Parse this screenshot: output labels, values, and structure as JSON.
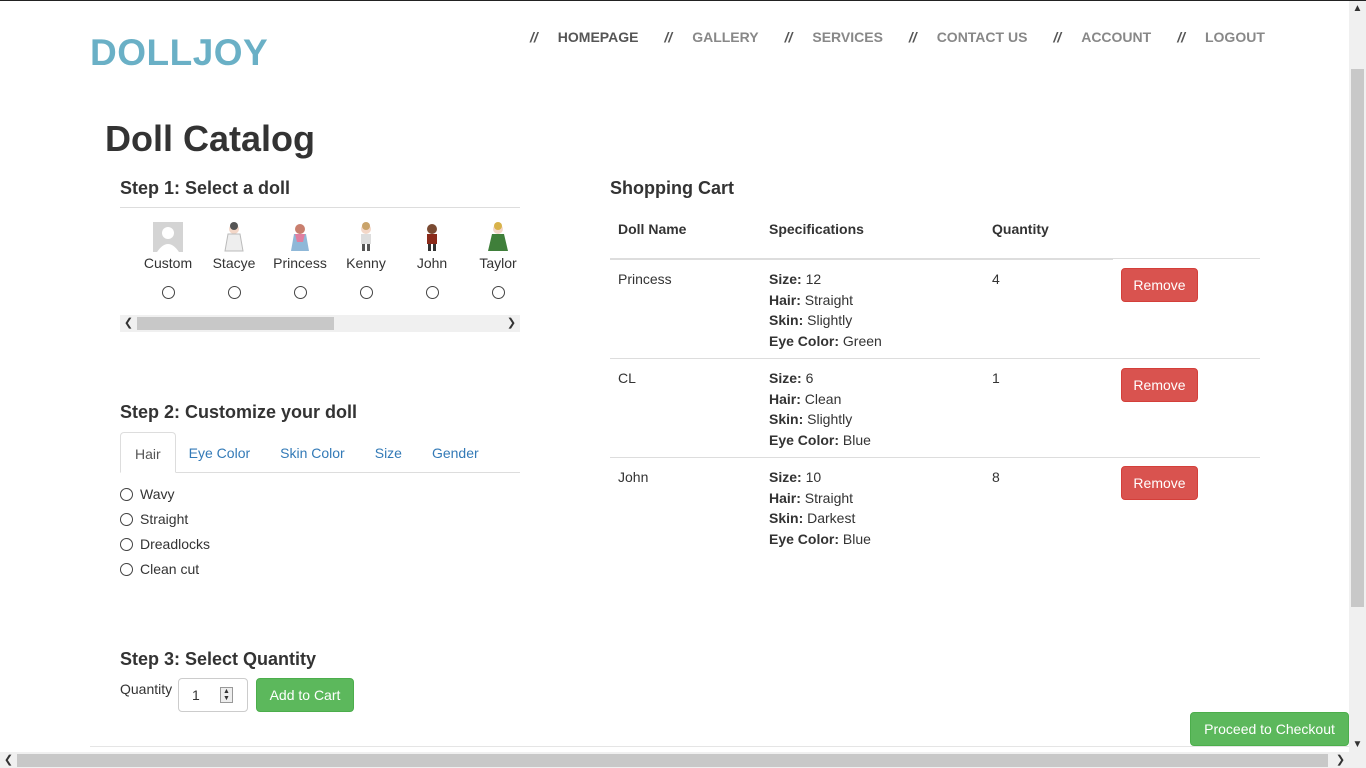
{
  "header": {
    "brand": "DOLLJOY",
    "separator": "//",
    "nav": [
      {
        "label": "HOMEPAGE",
        "active": true
      },
      {
        "label": "GALLERY",
        "active": false
      },
      {
        "label": "SERVICES",
        "active": false
      },
      {
        "label": "CONTACT US",
        "active": false
      },
      {
        "label": "ACCOUNT",
        "active": false
      },
      {
        "label": "LOGOUT",
        "active": false
      }
    ]
  },
  "page_title": "Doll Catalog",
  "step1": {
    "heading": "Step 1: Select a doll",
    "dolls": [
      {
        "name": "Custom",
        "icon": "custom-avatar-icon",
        "color": "#b5b5b5"
      },
      {
        "name": "Stacye",
        "icon": "doll-stacye-icon",
        "color": "#e8e8e8"
      },
      {
        "name": "Princess",
        "icon": "doll-princess-icon",
        "color": "#8fb8d8"
      },
      {
        "name": "Kenny",
        "icon": "doll-kenny-icon",
        "color": "#d8d8d8"
      },
      {
        "name": "John",
        "icon": "doll-john-icon",
        "color": "#7a3a2a"
      },
      {
        "name": "Taylor",
        "icon": "doll-taylor-icon",
        "color": "#3f7f3a"
      }
    ]
  },
  "step2": {
    "heading": "Step 2: Customize your doll",
    "tabs": [
      "Hair",
      "Eye Color",
      "Skin Color",
      "Size",
      "Gender"
    ],
    "active_tab": "Hair",
    "options": [
      "Wavy",
      "Straight",
      "Dreadlocks",
      "Clean cut"
    ]
  },
  "step3": {
    "heading": "Step 3: Select Quantity",
    "quantity_label": "Quantity",
    "quantity_value": "1",
    "add_button": "Add to Cart"
  },
  "cart": {
    "heading": "Shopping Cart",
    "columns": [
      "Doll Name",
      "Specifications",
      "Quantity"
    ],
    "spec_labels": {
      "size": "Size:",
      "hair": "Hair:",
      "skin": "Skin:",
      "eye": "Eye Color:"
    },
    "remove_label": "Remove",
    "rows": [
      {
        "name": "Princess",
        "size": "12",
        "hair": "Straight",
        "skin": "Slightly",
        "eye": "Green",
        "quantity": "4"
      },
      {
        "name": "CL",
        "size": "6",
        "hair": "Clean",
        "skin": "Slightly",
        "eye": "Blue",
        "quantity": "1"
      },
      {
        "name": "John",
        "size": "10",
        "hair": "Straight",
        "skin": "Darkest",
        "eye": "Blue",
        "quantity": "8"
      }
    ]
  },
  "checkout_button": "Proceed to Checkout",
  "colors": {
    "brand": "#6ab0c6",
    "success": "#5cb85c",
    "danger": "#d9534f",
    "link": "#337ab7"
  }
}
